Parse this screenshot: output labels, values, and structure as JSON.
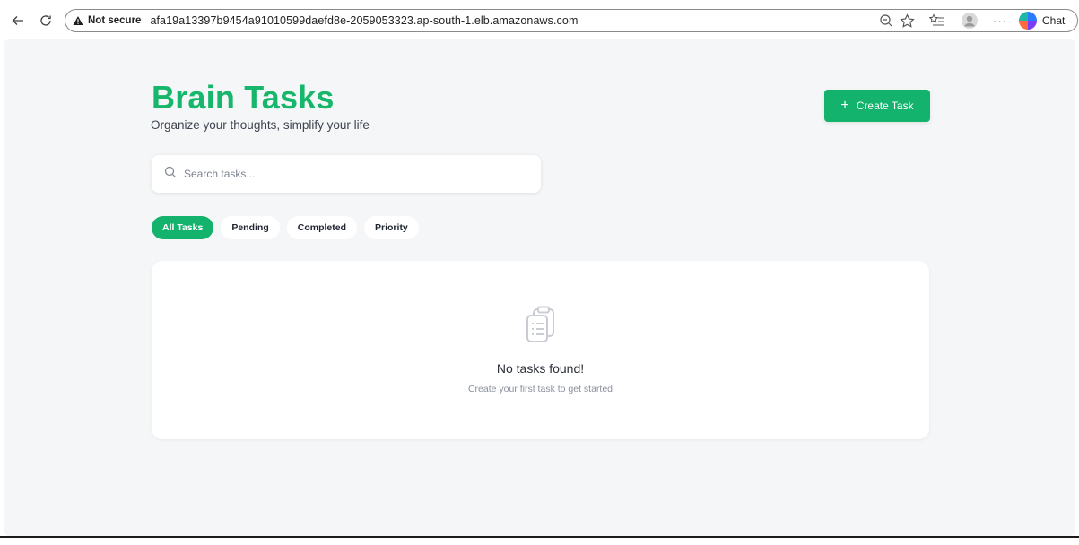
{
  "browser": {
    "security_label": "Not secure",
    "url": "afa19a13397b9454a91010599daefd8e-2059053323.ap-south-1.elb.amazonaws.com",
    "chat_label": "Chat",
    "icons": [
      "back-icon",
      "reload-icon",
      "warning-icon",
      "zoom-icon",
      "favorite-star-icon",
      "favorites-list-icon",
      "profile-icon",
      "more-icon",
      "copilot-icon"
    ]
  },
  "header": {
    "title": "Brain Tasks",
    "tagline": "Organize your thoughts, simplify your life",
    "create_button_label": "Create Task"
  },
  "search": {
    "placeholder": "Search tasks..."
  },
  "filters": [
    {
      "label": "All Tasks",
      "active": true
    },
    {
      "label": "Pending",
      "active": false
    },
    {
      "label": "Completed",
      "active": false
    },
    {
      "label": "Priority",
      "active": false
    }
  ],
  "empty_state": {
    "title": "No tasks found!",
    "subtitle": "Create your first task to get started"
  },
  "colors": {
    "accent": "#13b26d",
    "brand_title": "#16b76b",
    "page_background": "#f5f6f7"
  }
}
